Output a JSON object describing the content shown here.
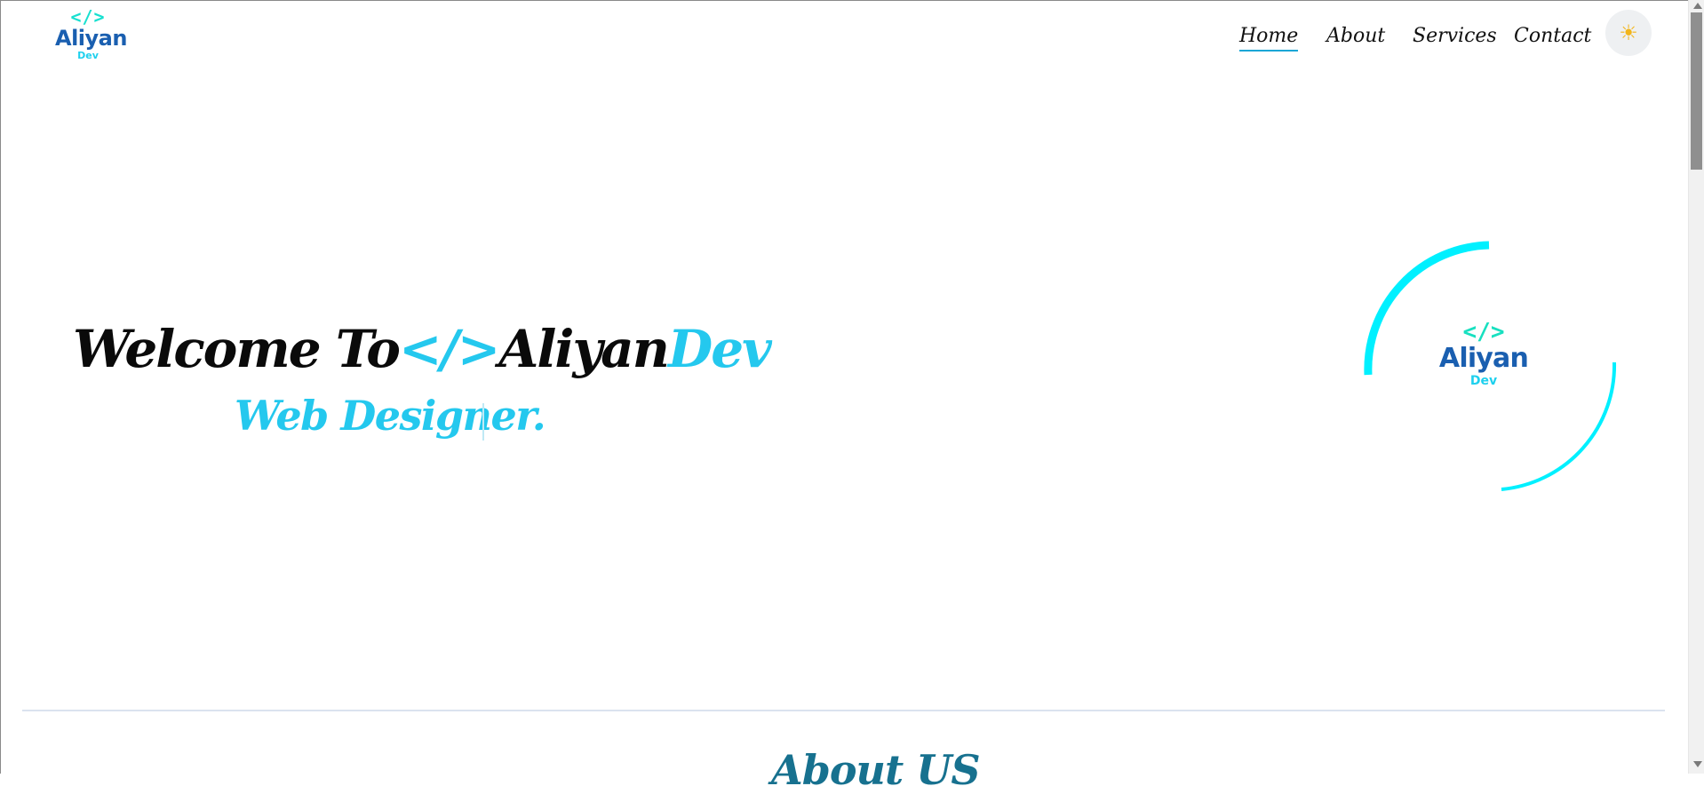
{
  "logo": {
    "code": "</>",
    "name": "Aliyan",
    "sub": "Dev"
  },
  "nav": {
    "items": [
      {
        "label": "Home",
        "active": true
      },
      {
        "label": "About"
      },
      {
        "label": "Services"
      },
      {
        "label": "Contact"
      }
    ],
    "theme_icon": "sun-icon",
    "theme_glyph": "☀"
  },
  "hero": {
    "title_prefix": "Welcome To",
    "title_code": "</>",
    "title_brand": "Aliyan",
    "title_accent": "Dev",
    "subtitle": "Web Designer."
  },
  "orbit_logo": {
    "code": "</>",
    "name": "Aliyan",
    "sub": "Dev"
  },
  "about": {
    "heading": "About US"
  },
  "colors": {
    "accent": "#24c8ee",
    "brand_blue": "#1a5fb0",
    "ring": "#00f0ff",
    "heading_teal": "#17718f"
  }
}
